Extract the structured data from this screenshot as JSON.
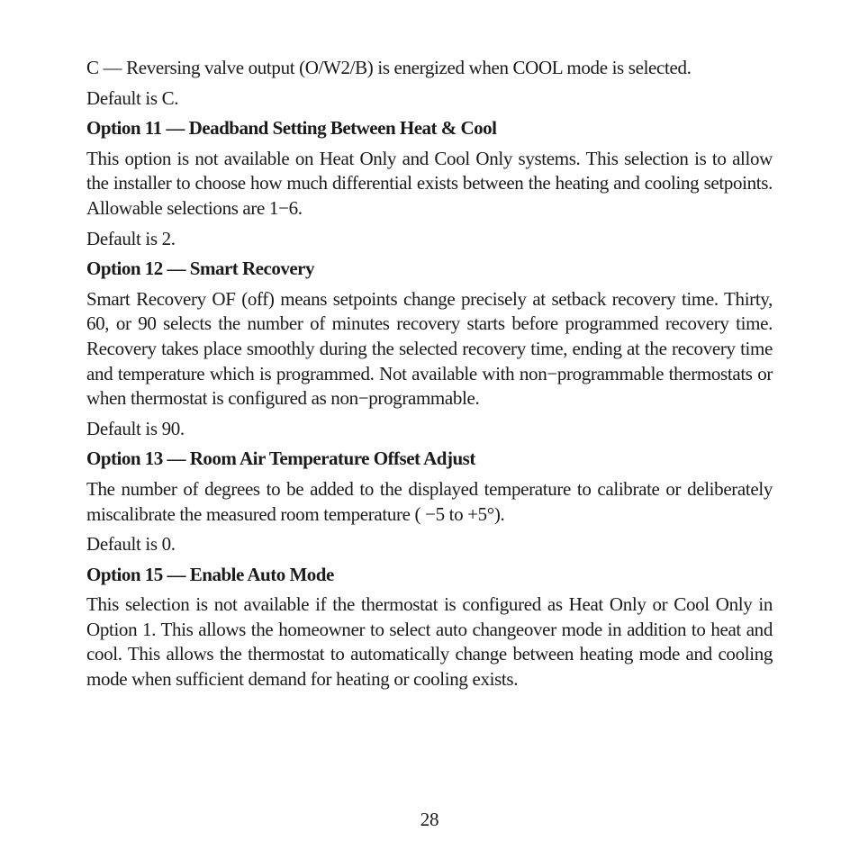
{
  "document": {
    "intro": {
      "text": "C — Reversing valve output (O/W2/B) is energized when COOL mode is selected.",
      "default": "Default is C."
    },
    "sections": [
      {
        "heading": "Option 11 — Deadband Setting Between Heat & Cool",
        "body": "This option is not available on Heat Only and Cool Only systems. This selection is to allow the installer to choose how much differential exists between the heating and cooling setpoints. Allowable selections are 1−6.",
        "default": "Default is 2."
      },
      {
        "heading": "Option 12 — Smart Recovery",
        "body": "Smart Recovery OF (off) means setpoints change precisely at setback recovery time. Thirty, 60, or 90 selects the number of minutes recovery starts before programmed recovery time. Recovery takes place smoothly during the selected recovery time, ending at the recovery time and temperature which is programmed. Not available with non−programmable thermostats or when thermostat is configured as non−programmable.",
        "default": "Default is 90."
      },
      {
        "heading": "Option 13 — Room Air Temperature Offset Adjust",
        "body": "The number of degrees to be added to the displayed temperature to calibrate or deliberately miscalibrate the measured room temperature ( −5 to +5°).",
        "default": "Default is 0."
      },
      {
        "heading": "Option 15 — Enable Auto Mode",
        "body": "This selection is not available if the thermostat is configured as Heat Only or Cool Only in Option 1. This allows the homeowner to select auto changeover mode in addition to heat and cool. This allows the thermostat to automatically change between heating mode and cooling mode when sufficient demand for heating or cooling exists."
      }
    ],
    "page_number": "28"
  }
}
